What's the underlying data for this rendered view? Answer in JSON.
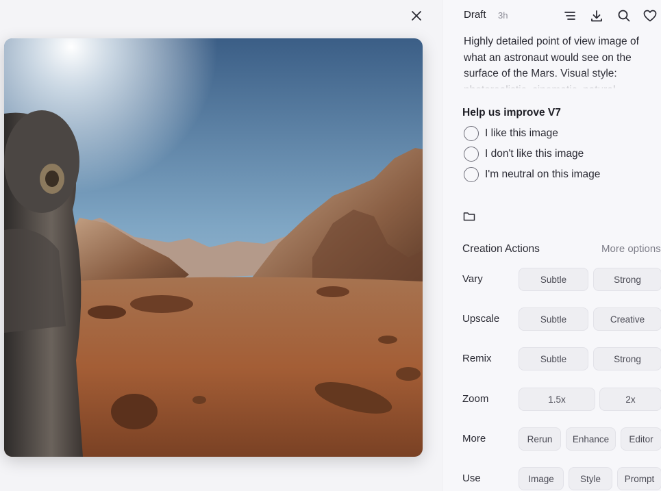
{
  "viewer": {
    "close_icon": "close-icon",
    "image_alt": "Astronaut view on Mars surface"
  },
  "panel": {
    "header": {
      "title": "Draft",
      "time": "3h",
      "icons": [
        "menu-icon",
        "download-icon",
        "search-icon",
        "heart-icon"
      ]
    },
    "prompt": "Highly detailed point of view image of what an astronaut would see on the surface of the Mars. Visual style: photorealistic, cinematic, natural",
    "feedback": {
      "title": "Help us improve V7",
      "options": [
        "I like this image",
        "I don't like this image",
        "I'm neutral on this image"
      ]
    },
    "folder_icon": "folder-icon",
    "actions": {
      "title": "Creation Actions",
      "more": "More options",
      "rows": [
        {
          "label": "Vary",
          "buttons": [
            "Subtle",
            "Strong"
          ]
        },
        {
          "label": "Upscale",
          "buttons": [
            "Subtle",
            "Creative"
          ]
        },
        {
          "label": "Remix",
          "buttons": [
            "Subtle",
            "Strong"
          ]
        },
        {
          "label": "Zoom",
          "buttons": [
            "1.5x",
            "2x"
          ]
        },
        {
          "label": "More",
          "buttons": [
            "Rerun",
            "Enhance",
            "Editor"
          ]
        },
        {
          "label": "Use",
          "buttons": [
            "Image",
            "Style",
            "Prompt"
          ]
        }
      ]
    }
  }
}
